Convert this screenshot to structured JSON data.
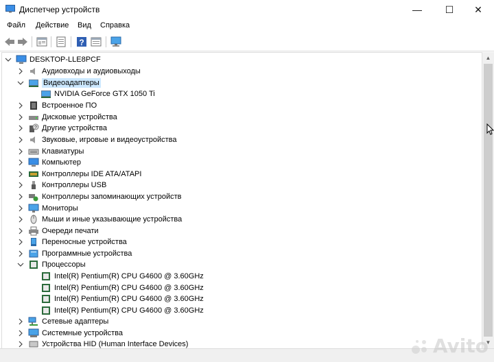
{
  "window": {
    "title": "Диспетчер устройств",
    "minimize": "—",
    "maximize": "☐",
    "close": "✕"
  },
  "menu": {
    "items": [
      "Файл",
      "Действие",
      "Вид",
      "Справка"
    ]
  },
  "toolbar": {
    "buttons": [
      "back-icon",
      "forward-icon",
      "properties-icon",
      "update-driver-icon",
      "help-icon",
      "show-hidden-icon",
      "scan-hardware-icon"
    ]
  },
  "tree": {
    "root": "DESKTOP-LLE8PCF",
    "categories": [
      {
        "label": "Аудиовходы и аудиовыходы",
        "icon": "audio-icon",
        "expanded": false
      },
      {
        "label": "Видеоадаптеры",
        "icon": "display-adapter-icon",
        "expanded": true,
        "selected": true,
        "children": [
          "NVIDIA GeForce GTX 1050 Ti"
        ]
      },
      {
        "label": "Встроенное ПО",
        "icon": "firmware-icon",
        "expanded": false
      },
      {
        "label": "Дисковые устройства",
        "icon": "disk-icon",
        "expanded": false
      },
      {
        "label": "Другие устройства",
        "icon": "unknown-device-icon",
        "expanded": false
      },
      {
        "label": "Звуковые, игровые и видеоустройства",
        "icon": "sound-icon",
        "expanded": false
      },
      {
        "label": "Клавиатуры",
        "icon": "keyboard-icon",
        "expanded": false
      },
      {
        "label": "Компьютер",
        "icon": "computer-icon",
        "expanded": false
      },
      {
        "label": "Контроллеры IDE ATA/ATAPI",
        "icon": "ide-controller-icon",
        "expanded": false
      },
      {
        "label": "Контроллеры USB",
        "icon": "usb-icon",
        "expanded": false
      },
      {
        "label": "Контроллеры запоминающих устройств",
        "icon": "storage-controller-icon",
        "expanded": false
      },
      {
        "label": "Мониторы",
        "icon": "monitor-icon",
        "expanded": false
      },
      {
        "label": "Мыши и иные указывающие устройства",
        "icon": "mouse-icon",
        "expanded": false
      },
      {
        "label": "Очереди печати",
        "icon": "printer-icon",
        "expanded": false
      },
      {
        "label": "Переносные устройства",
        "icon": "portable-device-icon",
        "expanded": false
      },
      {
        "label": "Программные устройства",
        "icon": "software-device-icon",
        "expanded": false
      },
      {
        "label": "Процессоры",
        "icon": "processor-icon",
        "expanded": true,
        "children": [
          "Intel(R) Pentium(R) CPU G4600 @ 3.60GHz",
          "Intel(R) Pentium(R) CPU G4600 @ 3.60GHz",
          "Intel(R) Pentium(R) CPU G4600 @ 3.60GHz",
          "Intel(R) Pentium(R) CPU G4600 @ 3.60GHz"
        ]
      },
      {
        "label": "Сетевые адаптеры",
        "icon": "network-icon",
        "expanded": false
      },
      {
        "label": "Системные устройства",
        "icon": "system-device-icon",
        "expanded": false
      },
      {
        "label": "Устройства HID (Human Interface Devices)",
        "icon": "hid-icon",
        "expanded": false
      }
    ]
  },
  "watermark": {
    "text": "Avito"
  },
  "colors": {
    "selection": "#cce8ff",
    "accent": "#0078d7"
  }
}
